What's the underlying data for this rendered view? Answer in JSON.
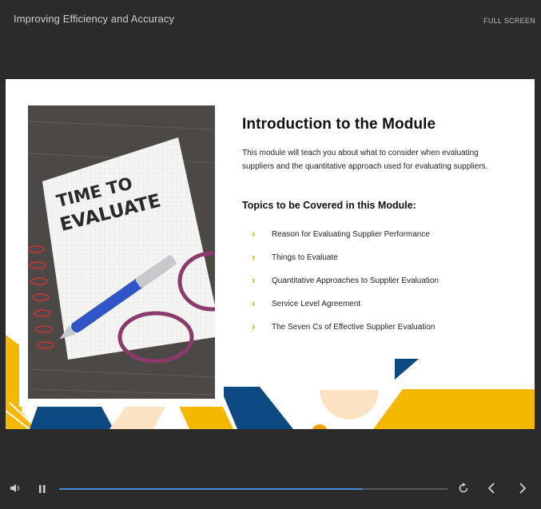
{
  "header": {
    "course_title": "Improving Efficiency and Accuracy",
    "fullscreen_label": "FULL SCREEN"
  },
  "slide": {
    "title": "Introduction to the Module",
    "intro": "This module will teach you about what to consider when evaluating suppliers and the quantitative approach used for evaluating suppliers.",
    "topics_heading": "Topics to be Covered in this Module:",
    "topics": [
      "Reason for Evaluating Supplier Performance",
      "Things to Evaluate",
      "Quantitative Approaches to Supplier Evaluation",
      "Service Level Agreement",
      "The Seven Cs of Effective Supplier Evaluation"
    ],
    "image_text": [
      "TIME TO",
      "EVALUATE"
    ]
  },
  "player": {
    "progress": 0.78,
    "icons": [
      "volume-icon",
      "pause-icon",
      "replay-icon",
      "previous-icon",
      "next-icon"
    ]
  },
  "colors": {
    "accent_yellow": "#f5b800",
    "navy": "#0d4a84",
    "peach": "#fce3c4",
    "progress_blue": "#4a90e2"
  }
}
